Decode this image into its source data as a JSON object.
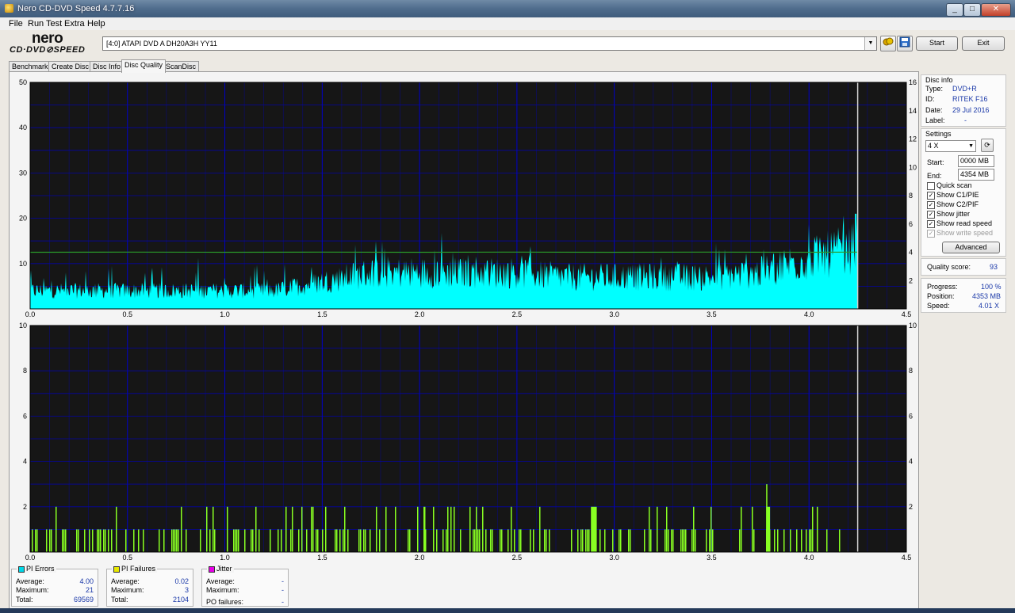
{
  "window": {
    "title": "Nero CD-DVD Speed 4.7.7.16",
    "min": "_",
    "max": "□",
    "close": "✕"
  },
  "menu": [
    "File",
    "Run Test",
    "Extra",
    "Help"
  ],
  "logo": {
    "line1": "nero",
    "line2": "CD·DVD⊘SPEED"
  },
  "drive": {
    "value": "[4:0]   ATAPI DVD A  DH20A3H YY11"
  },
  "buttons": {
    "start": "Start",
    "exit": "Exit",
    "advanced": "Advanced"
  },
  "tabs": [
    "Benchmark",
    "Create Disc",
    "Disc Info",
    "Disc Quality",
    "ScanDisc"
  ],
  "active_tab": "Disc Quality",
  "disc_info": {
    "title": "Disc info",
    "type_label": "Type:",
    "type": "DVD+R",
    "id_label": "ID:",
    "id": "RITEK F16",
    "date_label": "Date:",
    "date": "29 Jul 2016",
    "label_label": "Label:",
    "label": "-"
  },
  "settings": {
    "title": "Settings",
    "speed": "4 X",
    "start_label": "Start:",
    "start": "0000 MB",
    "end_label": "End:",
    "end": "4354 MB",
    "options": [
      {
        "label": "Quick scan",
        "checked": false,
        "disabled": false
      },
      {
        "label": "Show C1/PIE",
        "checked": true,
        "disabled": false
      },
      {
        "label": "Show C2/PIF",
        "checked": true,
        "disabled": false
      },
      {
        "label": "Show jitter",
        "checked": true,
        "disabled": false
      },
      {
        "label": "Show read speed",
        "checked": true,
        "disabled": false
      },
      {
        "label": "Show write speed",
        "checked": true,
        "disabled": true
      }
    ]
  },
  "quality": {
    "label": "Quality score:",
    "value": "93"
  },
  "progress": {
    "progress_label": "Progress:",
    "progress": "100 %",
    "position_label": "Position:",
    "position": "4353 MB",
    "speed_label": "Speed:",
    "speed": "4.01 X"
  },
  "stats": {
    "pi_errors": {
      "title": "PI Errors",
      "color": "#00d8e8",
      "avg_label": "Average:",
      "avg": "4.00",
      "max_label": "Maximum:",
      "max": "21",
      "total_label": "Total:",
      "total": "69569"
    },
    "pi_failures": {
      "title": "PI Failures",
      "color": "#e8e800",
      "avg_label": "Average:",
      "avg": "0.02",
      "max_label": "Maximum:",
      "max": "3",
      "total_label": "Total:",
      "total": "2104"
    },
    "jitter": {
      "title": "Jitter",
      "color": "#e800e8",
      "avg_label": "Average:",
      "avg": "-",
      "max_label": "Maximum:",
      "max": "-",
      "po_label": "PO failures:",
      "po": "-"
    }
  },
  "colors": {
    "plot_bg": "#161616",
    "grid": "#0000c8",
    "pie_fill": "#00ffff",
    "pif_bar": "#88ff22",
    "speed_line": "#2a9a2a",
    "end_marker": "#d0d0d0"
  },
  "chart_data": [
    {
      "type": "area",
      "name": "PI Errors / read speed",
      "x_ticks": [
        "0.0",
        "0.5",
        "1.0",
        "1.5",
        "2.0",
        "2.5",
        "3.0",
        "3.5",
        "4.0",
        "4.5"
      ],
      "y_left_ticks": [
        "10",
        "20",
        "30",
        "40",
        "50"
      ],
      "y_right_ticks": [
        "2",
        "4",
        "6",
        "8",
        "10",
        "12",
        "14",
        "16"
      ],
      "xlim": [
        0,
        4.5
      ],
      "ylim": [
        0,
        50
      ],
      "y2lim": [
        0,
        16
      ],
      "end_x": 4.25,
      "series": [
        {
          "name": "PI Errors",
          "x": [
            0.0,
            0.25,
            0.5,
            0.75,
            1.0,
            1.25,
            1.5,
            1.75,
            2.0,
            2.25,
            2.5,
            2.75,
            3.0,
            3.25,
            3.5,
            3.75,
            3.9,
            4.0,
            4.1,
            4.2,
            4.25
          ],
          "values": [
            4,
            4,
            4,
            4,
            4,
            4,
            6,
            8,
            8,
            8,
            8,
            7,
            7,
            7,
            7,
            8,
            10,
            11,
            12,
            13,
            14
          ]
        },
        {
          "name": "Read speed",
          "x": [
            0.0,
            0.5,
            1.0,
            1.5,
            2.0,
            2.5,
            3.0,
            3.5,
            4.0,
            4.25
          ],
          "values": [
            4.0,
            4.01,
            4.0,
            4.01,
            4.0,
            4.01,
            4.0,
            4.01,
            4.0,
            4.01
          ]
        }
      ]
    },
    {
      "type": "bar",
      "name": "PI Failures",
      "x_ticks": [
        "0.0",
        "0.5",
        "1.0",
        "1.5",
        "2.0",
        "2.5",
        "3.0",
        "3.5",
        "4.0",
        "4.5"
      ],
      "y_left_ticks": [
        "2",
        "4",
        "6",
        "8",
        "10"
      ],
      "y_right_ticks": [
        "2",
        "4",
        "6",
        "8",
        "10"
      ],
      "xlim": [
        0,
        4.5
      ],
      "ylim": [
        0,
        10
      ],
      "end_x": 4.25,
      "max_point": {
        "x": 3.78,
        "y": 3
      }
    }
  ]
}
